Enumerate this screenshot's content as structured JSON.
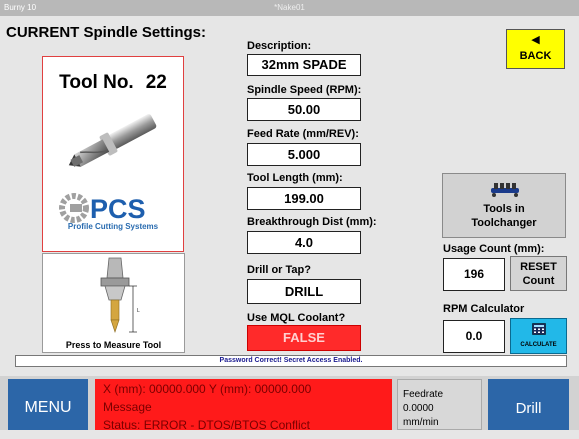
{
  "titlebar": {
    "app_name": "Burny 10",
    "center_text": "*Nake01"
  },
  "heading": "CURRENT Spindle Settings:",
  "tool": {
    "label": "Tool No.",
    "number": "22",
    "logo_sub": "Profile Cutting Systems"
  },
  "measure": {
    "label": "Press to Measure Tool"
  },
  "fields": {
    "description": {
      "label": "Description:",
      "value": "32mm SPADE"
    },
    "spindle_speed": {
      "label": "Spindle Speed (RPM):",
      "value": "50.00"
    },
    "feed_rate": {
      "label": "Feed Rate (mm/REV):",
      "value": "5.000"
    },
    "tool_length": {
      "label": "Tool Length (mm):",
      "value": "199.00"
    },
    "breakthrough": {
      "label": "Breakthrough Dist (mm):",
      "value": "4.0"
    },
    "drill_or_tap": {
      "label": "Drill or Tap?",
      "value": "DRILL"
    },
    "mql_coolant": {
      "label": "Use MQL Coolant?",
      "value": "FALSE"
    }
  },
  "back": {
    "label": "BACK",
    "icon": "back-arrow-icon"
  },
  "tools_changer": {
    "line1": "Tools in",
    "line2": "Toolchanger",
    "icon": "toolchanger-icon"
  },
  "usage": {
    "label": "Usage Count (mm):",
    "value": "196",
    "reset_line1": "RESET",
    "reset_line2": "Count"
  },
  "rpm_calc": {
    "label": "RPM Calculator",
    "value": "0.0",
    "button": "CALCULATE",
    "icon": "calculator-icon"
  },
  "status_message": "Password Correct! Secret Access Enabled.",
  "bottom": {
    "menu": "MENU",
    "coords": "X (mm): 00000.000   Y (mm): 00000.000",
    "message": "Message",
    "status": "Status: ERROR - DTOS/BTOS Conflict",
    "feed_label": "Feedrate",
    "feed_value": "0.0000",
    "feed_unit": "mm/min",
    "drill": "Drill"
  },
  "colors": {
    "accent_blue": "#2c66a8",
    "alert_red": "#ff1a1a",
    "back_yellow": "#ffff00",
    "calc_cyan": "#22b8e8"
  }
}
